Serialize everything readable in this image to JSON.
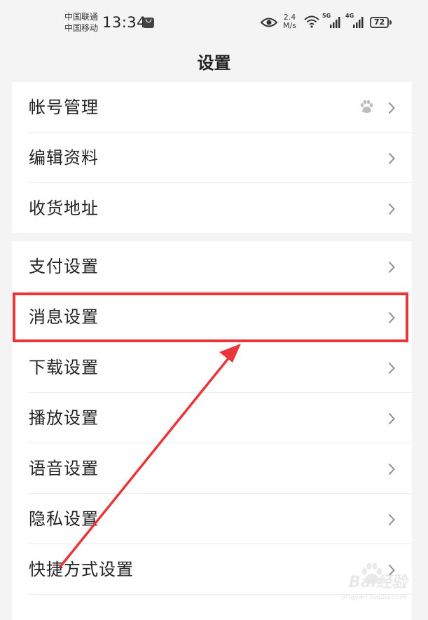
{
  "status_bar": {
    "carrier_1": "中国联通",
    "carrier_2": "中国移动",
    "time": "13:34",
    "speed_value": "2.4",
    "speed_unit": "M/s",
    "network_1": "5G",
    "network_2": "4G",
    "battery": "72"
  },
  "header": {
    "title": "设置"
  },
  "groups": [
    {
      "items": [
        {
          "label": "帐号管理",
          "extra_icon": "paw-icon"
        },
        {
          "label": "编辑资料"
        },
        {
          "label": "收货地址"
        }
      ]
    },
    {
      "items": [
        {
          "label": "支付设置"
        },
        {
          "label": "消息设置"
        },
        {
          "label": "下载设置"
        },
        {
          "label": "播放设置"
        },
        {
          "label": "语音设置"
        },
        {
          "label": "隐私设置"
        },
        {
          "label": "快捷方式设置"
        }
      ]
    }
  ],
  "annotation": {
    "highlight_color": "#e8363a",
    "highlighted_item": "消息设置"
  },
  "watermark": {
    "text": "Bai经验",
    "sub": "jingyan.baidu.com"
  }
}
